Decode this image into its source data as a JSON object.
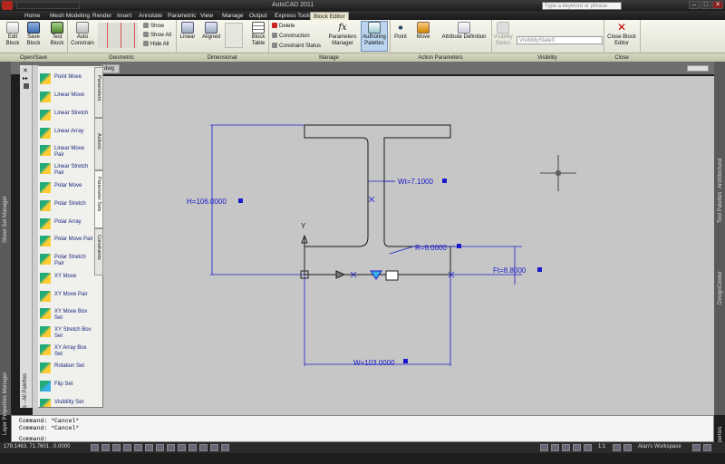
{
  "window": {
    "title": "AutoCAD 2011",
    "search_placeholder": "Type a keyword or phrase",
    "min": "–",
    "max": "□",
    "close": "✕"
  },
  "ribbon_tabs": [
    "Home",
    "Mesh Modeling",
    "Render",
    "Insert",
    "Annotate",
    "Parametric",
    "View",
    "Manage",
    "Output",
    "Express Tools",
    "Block Editor"
  ],
  "ribbon": {
    "open_save": {
      "edit_block": "Edit Block",
      "save_block": "Save Block",
      "panel": "Open/Save"
    },
    "test_block": "Test Block",
    "geometric": {
      "auto_constrain": "Auto Constrain",
      "show": "Show",
      "show_all": "Show All",
      "hide_all": "Hide All",
      "panel": "Geometric"
    },
    "dimensional": {
      "linear": "Linear",
      "aligned": "Aligned",
      "block_table": "Block Table",
      "panel": "Dimensional"
    },
    "manage": {
      "delete": "Delete",
      "construction": "Construction",
      "constraint_status": "Constraint Status",
      "parameters_manager": "Parameters Manager",
      "authoring_palettes": "Authoring Palettes",
      "panel": "Manage"
    },
    "action_parameters": {
      "point": "Point",
      "move": "Move",
      "attribute_definition": "Attribute Definition",
      "panel": "Action Parameters"
    },
    "visibility": {
      "visibility_states": "Visibility States",
      "state_value": "VisibilityState0",
      "panel": "Visibility"
    },
    "close": {
      "close_block_editor": "Close Block Editor",
      "panel": "Close"
    }
  },
  "doc_tab": "dwg",
  "palette": {
    "title": "Block Authoring Palettes - All Palettes",
    "tabs": [
      "Parameters",
      "Actions",
      "Parameter Sets",
      "Constraints"
    ],
    "items": [
      "Point Move",
      "Linear Move",
      "Linear Stretch",
      "Linear Array",
      "Linear Move Pair",
      "Linear Stretch Pair",
      "Polar Move",
      "Polar Stretch",
      "Polar Array",
      "Polar Move Pair",
      "Polar Stretch Pair",
      "XY Move",
      "XY Move Pair",
      "XY Move Box Set",
      "XY Stretch Box Set",
      "XY Array Box Set",
      "Rotation Set",
      "Flip Set",
      "Visibility Set"
    ]
  },
  "side_labels": {
    "left": [
      "Sheet Set Manager",
      "Layer Properties Manager"
    ],
    "right": [
      "Architectural",
      "Tool Palettes",
      "DesignCenter",
      "Properties"
    ]
  },
  "drawing": {
    "H": "H=106.0000",
    "Wt": "Wt=7.1000",
    "R": "R=6.0000",
    "Ft": "Ft=8.8000",
    "W": "W=103.0000",
    "ucs_y": "Y"
  },
  "command": {
    "line1": "Command: *Cancel*",
    "line2": "Command: *Cancel*",
    "prompt": "Command:"
  },
  "status": {
    "coords": "179.1463, 71.7601 , 0.0000",
    "scale": "1:1",
    "workspace": "Alan's Workspace"
  },
  "colors": {
    "dimension": "#1a1acc",
    "canvas": "#c6c6c6",
    "active_tab": "#e9e7c9"
  }
}
